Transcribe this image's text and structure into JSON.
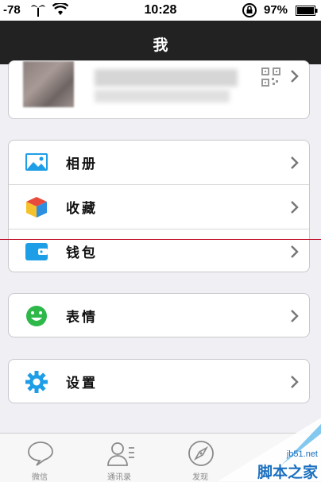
{
  "status_bar": {
    "signal": "-78",
    "time": "10:28",
    "battery": "97%"
  },
  "nav": {
    "title": "我"
  },
  "menu": {
    "album": "相册",
    "favorites": "收藏",
    "wallet": "钱包",
    "stickers": "表情",
    "settings": "设置"
  },
  "tabs": [
    {
      "label": "微信",
      "icon": "chat-bubble-icon"
    },
    {
      "label": "通讯录",
      "icon": "contacts-icon"
    },
    {
      "label": "发现",
      "icon": "compass-icon"
    }
  ],
  "watermark": {
    "site": "jb51.net",
    "name": "脚本之家"
  },
  "colors": {
    "nav_bg": "#222222",
    "album_icon": "#1e9ee6",
    "wallet_icon": "#1e9ee6",
    "emoji_icon": "#2fb84a",
    "settings_icon": "#1e9ee6"
  }
}
